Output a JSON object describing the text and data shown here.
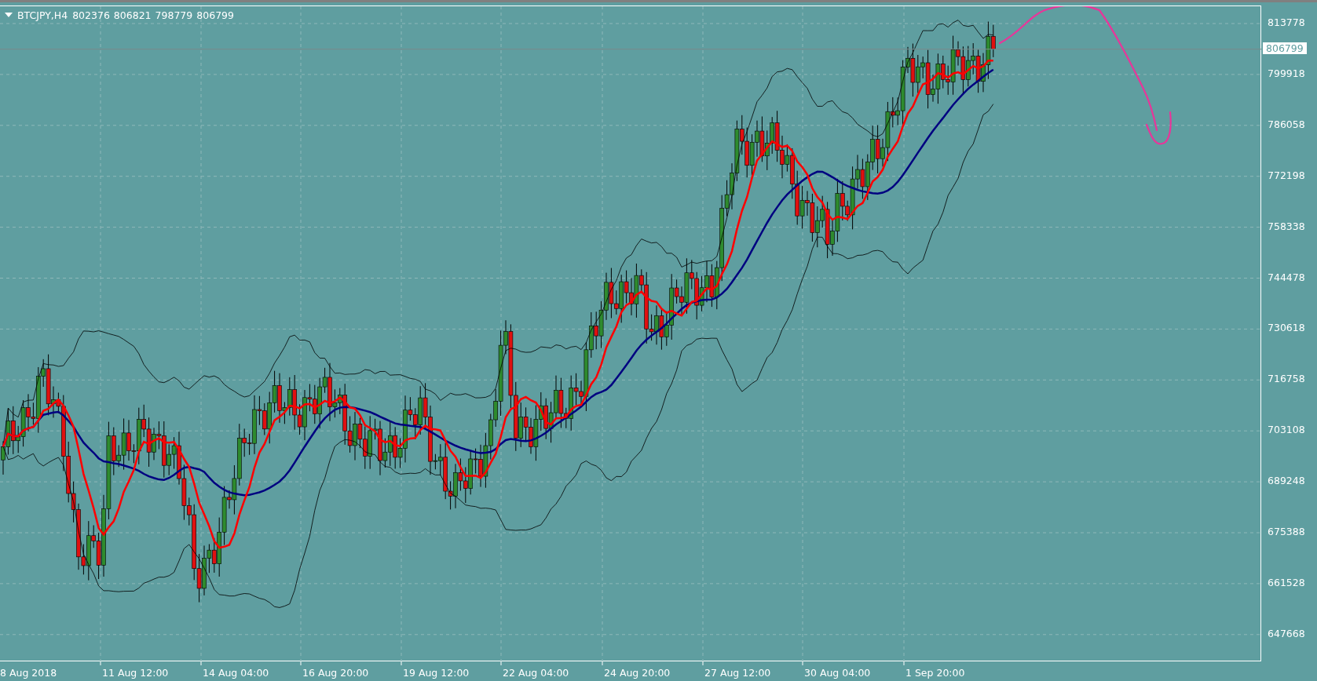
{
  "chart_header": {
    "symbol": "BTCJPY,H4",
    "quotes": [
      "802376",
      "806821",
      "798779",
      "806799"
    ]
  },
  "price_axis": {
    "labels": [
      "813778",
      "799918",
      "786058",
      "772198",
      "758338",
      "744478",
      "730618",
      "716758",
      "703108",
      "689248",
      "675388",
      "661528",
      "647668"
    ],
    "current_price": "806799"
  },
  "time_axis": {
    "labels": [
      "8 Aug 2018",
      "11 Aug 12:00",
      "14 Aug 04:00",
      "16 Aug 20:00",
      "19 Aug 12:00",
      "22 Aug 04:00",
      "24 Aug 20:00",
      "27 Aug 12:00",
      "30 Aug 04:00",
      "1 Sep 20:00"
    ]
  }
}
